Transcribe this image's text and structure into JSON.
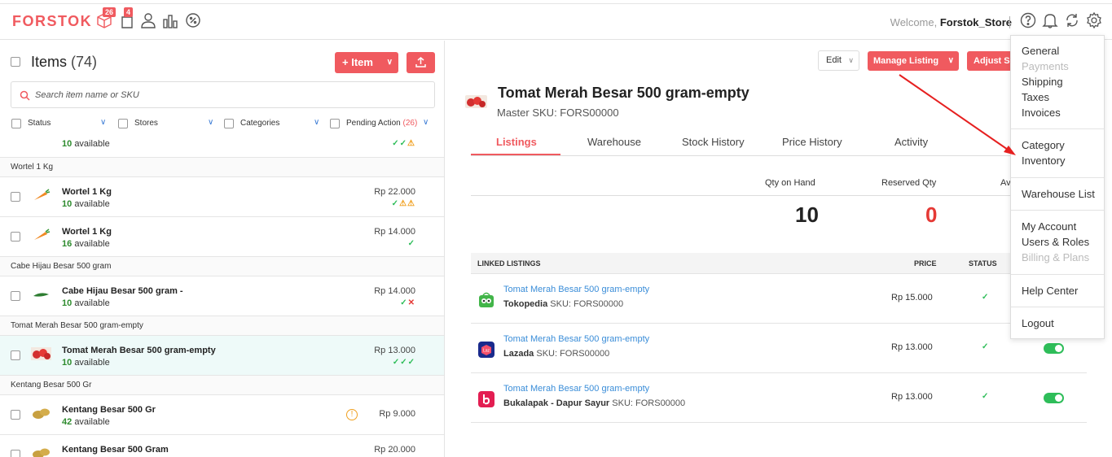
{
  "header": {
    "logo": "FORSTOK",
    "icons": [
      {
        "name": "box-icon",
        "badge": "26"
      },
      {
        "name": "bag-icon",
        "badge": "4"
      },
      {
        "name": "user-icon"
      },
      {
        "name": "bar-chart-icon"
      },
      {
        "name": "discount-icon"
      }
    ],
    "welcome_prefix": "Welcome,",
    "store_name": "Forstok_Store"
  },
  "left": {
    "title": "Items",
    "count": "(74)",
    "add_item_label": "+ Item",
    "search_placeholder": "Search item name or SKU",
    "filters": {
      "status": "Status",
      "stores": "Stores",
      "categories": "Categories",
      "pending": "Pending Action",
      "pending_count": "(26)"
    },
    "top_partial": {
      "available": "10",
      "available_label": "available",
      "status": "✓✓⚠"
    },
    "groups": [
      {
        "group": "Wortel 1 Kg",
        "items": [
          {
            "name": "Wortel 1 Kg",
            "available": "10",
            "price": "Rp 22.000",
            "status": "✓⚠⚠"
          },
          {
            "name": "Wortel 1 Kg",
            "available": "16",
            "price": "Rp 14.000",
            "status": "✓"
          }
        ]
      },
      {
        "group": "Cabe Hijau Besar 500 gram",
        "items": [
          {
            "name": "Cabe Hijau Besar 500 gram -",
            "available": "10",
            "price": "Rp 14.000",
            "status": "✓✕"
          }
        ]
      },
      {
        "group": "Tomat Merah Besar 500 gram-empty",
        "items": [
          {
            "name": "Tomat Merah Besar 500 gram-empty",
            "available": "10",
            "price": "Rp 13.000",
            "status": "✓✓✓"
          }
        ]
      },
      {
        "group": "Kentang Besar 500 Gr",
        "items": [
          {
            "name": "Kentang Besar 500 Gr",
            "available": "42",
            "price": "Rp 9.000",
            "status": ""
          },
          {
            "name": "Kentang Besar 500 Gram",
            "available": "",
            "price": "Rp 20.000",
            "status": ""
          }
        ]
      }
    ],
    "available_label": "available"
  },
  "right": {
    "edit_label": "Edit",
    "manage_listing_label": "Manage Listing",
    "adjust_label": "Adjust S",
    "product_name": "Tomat Merah Besar 500 gram-empty",
    "master_sku": "Master SKU: FORS00000",
    "tabs": [
      "Listings",
      "Warehouse",
      "Stock History",
      "Price History",
      "Activity"
    ],
    "qty_on_hand_label": "Qty on Hand",
    "qty_on_hand": "10",
    "reserved_qty_label": "Reserved Qty",
    "reserved_qty": "0",
    "available_label_partial": "Av",
    "linked_header": {
      "listings": "LINKED LISTINGS",
      "price": "PRICE",
      "status": "STATUS"
    },
    "listings": [
      {
        "title": "Tomat Merah Besar 500 gram-empty",
        "store": "Tokopedia",
        "sku": "SKU: FORS00000",
        "price": "Rp  15.000",
        "logo": "tokopedia-logo",
        "color": "#42b549"
      },
      {
        "title": "Tomat Merah Besar 500 gram-empty",
        "store": "Lazada",
        "sku": "SKU: FORS00000",
        "price": "Rp  13.000",
        "logo": "lazada-logo",
        "color": "#1a2a8c"
      },
      {
        "title": "Tomat Merah Besar 500 gram-empty",
        "store": "Bukalapak - Dapur Sayur",
        "sku": "SKU: FORS00000",
        "price": "Rp  13.000",
        "logo": "bukalapak-logo",
        "color": "#e31e52"
      }
    ]
  },
  "menu": {
    "items": [
      "General",
      "Payments",
      "Shipping",
      "Taxes",
      "Invoices",
      "Category",
      "Inventory",
      "Warehouse List",
      "My Account",
      "Users & Roles",
      "Billing & Plans",
      "Help Center",
      "Logout"
    ]
  },
  "colors": {
    "accent": "#f05a5f",
    "ok": "#2ebd59",
    "link": "#3a8dd8",
    "annotation_arrow": "#e62020"
  }
}
